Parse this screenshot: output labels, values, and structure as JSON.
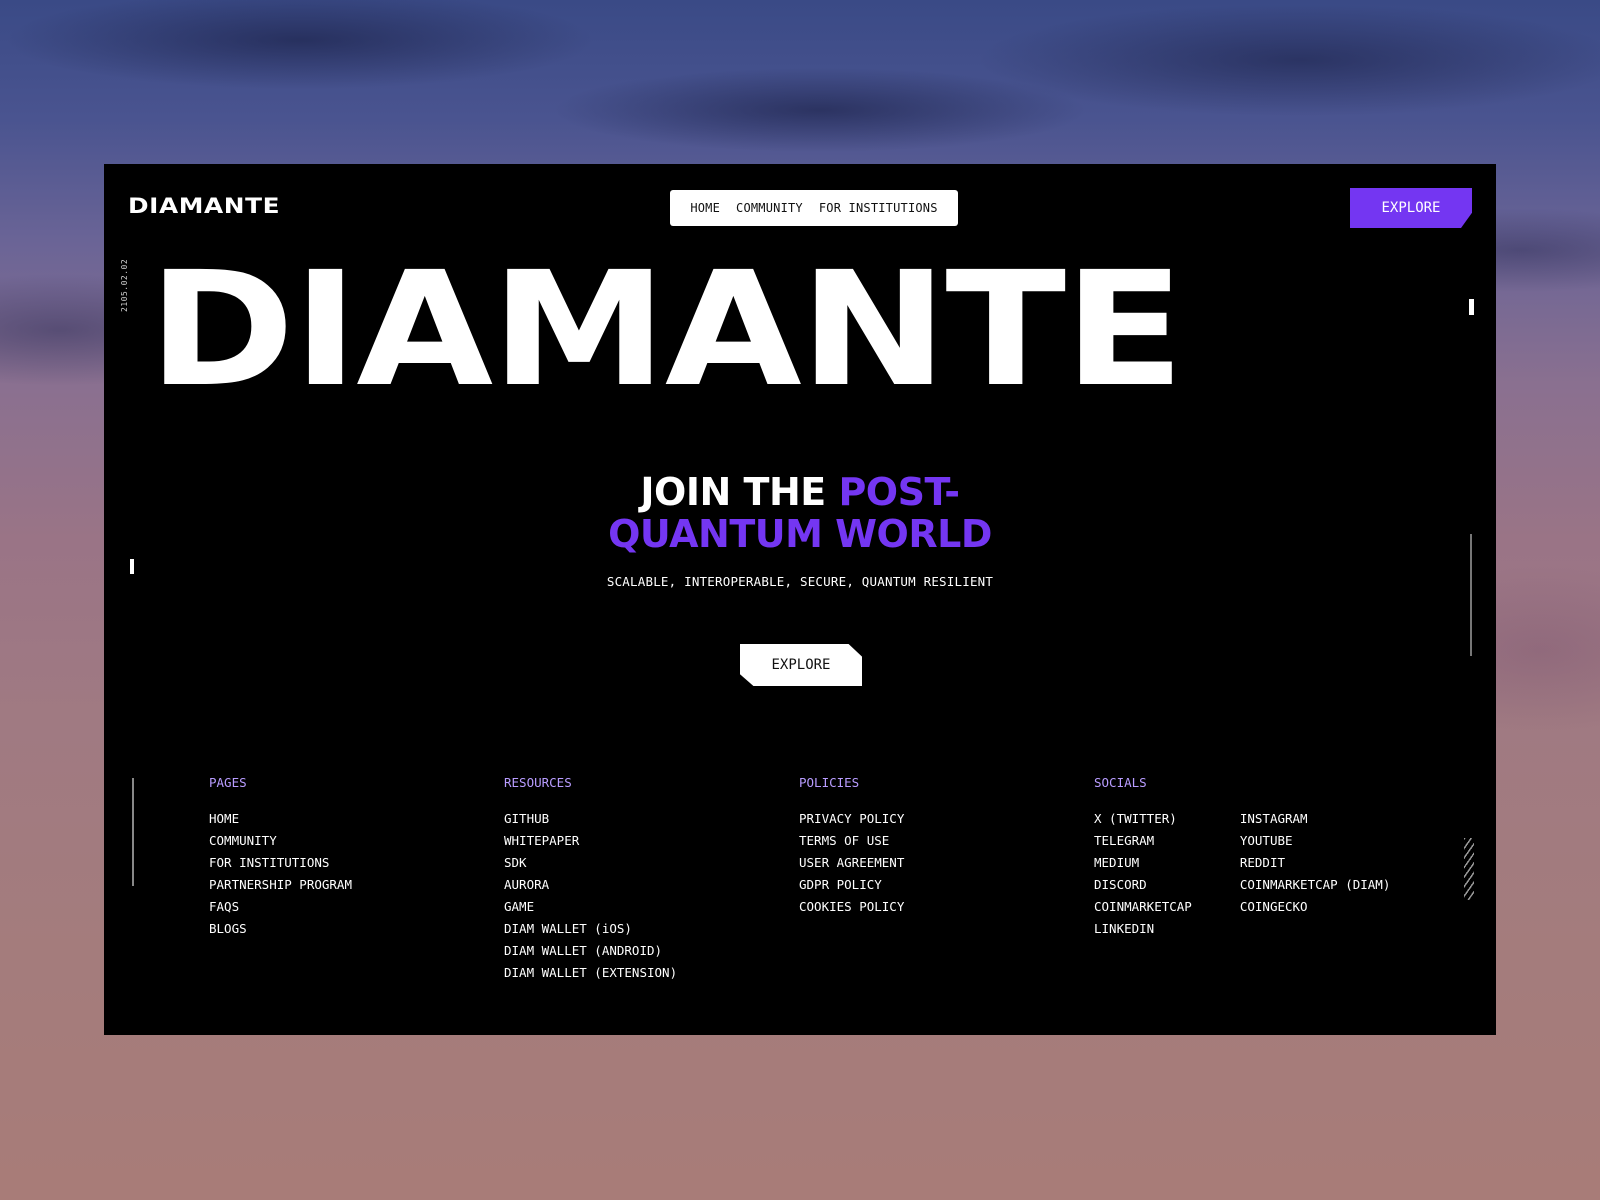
{
  "header": {
    "logo": "DIAMANTE",
    "nav": [
      "HOME",
      "COMMUNITY",
      "FOR INSTITUTIONS"
    ],
    "cta": "EXPLORE"
  },
  "hero": {
    "date": "2105.02.02",
    "title": "DIAMANTE",
    "headline_white": "JOIN THE ",
    "headline_purple_1": "POST-",
    "headline_purple_2": "QUANTUM WORLD",
    "subline": "SCALABLE, INTEROPERABLE, SECURE, QUANTUM RESILIENT",
    "cta": "EXPLORE"
  },
  "footer": {
    "pages": {
      "title": "PAGES",
      "links": [
        "HOME",
        "COMMUNITY",
        "FOR INSTITUTIONS",
        "PARTNERSHIP PROGRAM",
        "FAQS",
        "BLOGS"
      ]
    },
    "resources": {
      "title": "RESOURCES",
      "links": [
        "GITHUB",
        "WHITEPAPER",
        "SDK",
        "AURORA",
        "GAME",
        "DIAM WALLET (iOS)",
        "DIAM WALLET (ANDROID)",
        "DIAM WALLET (EXTENSION)"
      ]
    },
    "policies": {
      "title": "POLICIES",
      "links": [
        "PRIVACY POLICY",
        "TERMS OF USE",
        "USER AGREEMENT",
        "GDPR POLICY",
        "COOKIES POLICY"
      ]
    },
    "socials": {
      "title": "SOCIALS",
      "col1": [
        "X (TWITTER)",
        "TELEGRAM",
        "MEDIUM",
        "DISCORD",
        "COINMARKETCAP",
        "LINKEDIN"
      ],
      "col2": [
        "INSTAGRAM",
        "YOUTUBE",
        "REDDIT",
        "COINMARKETCAP (DIAM)",
        "COINGECKO"
      ]
    }
  },
  "colors": {
    "accent": "#7436f2",
    "footer_heading": "#b89cff",
    "background": "#000000"
  }
}
